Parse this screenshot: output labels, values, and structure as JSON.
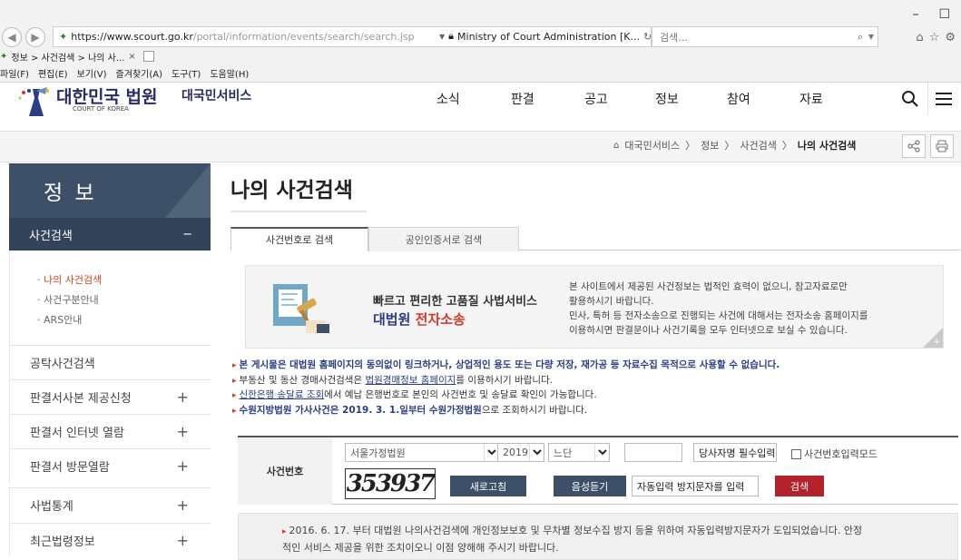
{
  "browser": {
    "url_host": "https://www.scourt.go.kr",
    "url_path": "/portal/information/events/search/search.jsp",
    "site_identity": "Ministry of Court Administration [K...",
    "search_placeholder": "검색...",
    "tab_title": "정보 > 사건검색 > 나의 사...",
    "tab_close": "×",
    "menus": [
      "파일(F)",
      "편집(E)",
      "보기(V)",
      "즐겨찾기(A)",
      "도구(T)",
      "도움말(H)"
    ]
  },
  "header": {
    "logo_title": "대한민국 법원",
    "logo_subtitle": "COURT OF KOREA",
    "service_name": "대국민서비스",
    "nav": [
      "소식",
      "판결",
      "공고",
      "정보",
      "참여",
      "자료"
    ]
  },
  "breadcrumb": {
    "items": [
      "대국민서비스",
      "정보",
      "사건검색",
      "나의 사건검색"
    ],
    "sep": "〉"
  },
  "sidebar": {
    "title": "정 보",
    "active": {
      "label": "사건검색",
      "toggle": "−"
    },
    "sub_items": [
      {
        "label": "· 나의 사건검색",
        "active": true
      },
      {
        "label": "· 사건구분안내",
        "active": false
      },
      {
        "label": "· ARS안내",
        "active": false
      }
    ],
    "items": [
      {
        "label": "공탁사건검색",
        "toggle": ""
      },
      {
        "label": "판결서사본 제공신청",
        "toggle": "+"
      },
      {
        "label": "판결서 인터넷 열람",
        "toggle": "+"
      },
      {
        "label": "판결서 방문열람",
        "toggle": "+"
      },
      {
        "label": "사법통계",
        "toggle": "+"
      },
      {
        "label": "최근법령정보",
        "toggle": "+"
      }
    ]
  },
  "main": {
    "page_title": "나의 사건검색",
    "tabs": [
      "사건번호로 검색",
      "공인인증서로 검색"
    ],
    "banner": {
      "headline": "빠르고 편리한 고품질 사법서비스",
      "brand_blue": "대법원",
      "brand_red": "전자소송",
      "lines": [
        "본 사이트에서 제공된 사건정보는 법적인 효력이 없으니, 참고자료로만",
        "활용하시기 바랍니다.",
        "민사, 특허 등 전자소송으로 진행되는 사건에 대해서는 전자소송 홈페이지를",
        "이용하시면 판결문이나 사건기록을 모두 인터넷으로 보실 수 있습니다."
      ],
      "more": "+"
    },
    "notices": {
      "bullet": "▸",
      "n1": "본 게시물은 대법원 홈페이지의 동의없이 링크하거나, 상업적인 용도 또는 다량 저장, 재가공 등 자료수집 목적으로 사용할 수 없습니다.",
      "n2_a": "부동산 및 동산 경매사건검색은 ",
      "n2_link": "법원경매정보 홈페이지",
      "n2_b": "를 이용하시기 바랍니다.",
      "n3_link": "신한은행 송달료 조회",
      "n3_b": "에서 예납 은행번호로 본인의 사건번호 및 송달료 확인이 가능합니다.",
      "n4_bold": "수원지방법원 가사사건은 2019. 3. 1.일부터 수원가정법원",
      "n4_b": "으로 조회하시기 바랍니다."
    },
    "form": {
      "label": "사건번호",
      "court": "서울가정법원",
      "year": "2019",
      "case_type": "느단",
      "case_number": "",
      "party_name": "당사자명 필수입력",
      "mode_checkbox": "사건번호입력모드",
      "captcha_text": "353937",
      "refresh": "새로고침",
      "audio": "음성듣기",
      "captcha_input": "자동입력 방지문자를 입력",
      "search": "검색"
    },
    "info": {
      "bullet": "▸",
      "line1": "2016. 6. 17. 부터 대법원 나의사건검색에 개인정보보호 및 무차별 정보수집 방지 등을 위하여 자동입력방지문자가 도입되었습니다. 안정",
      "line2": "적인 서비스 제공을 위한 조치이오니 이점 양해해 주시기 바랍니다."
    }
  },
  "colors": {
    "sidebar_title": "#3e5068",
    "sidebar_active": "#33445a",
    "accent_red": "#b2232b",
    "link_blue": "#2a3d86"
  }
}
